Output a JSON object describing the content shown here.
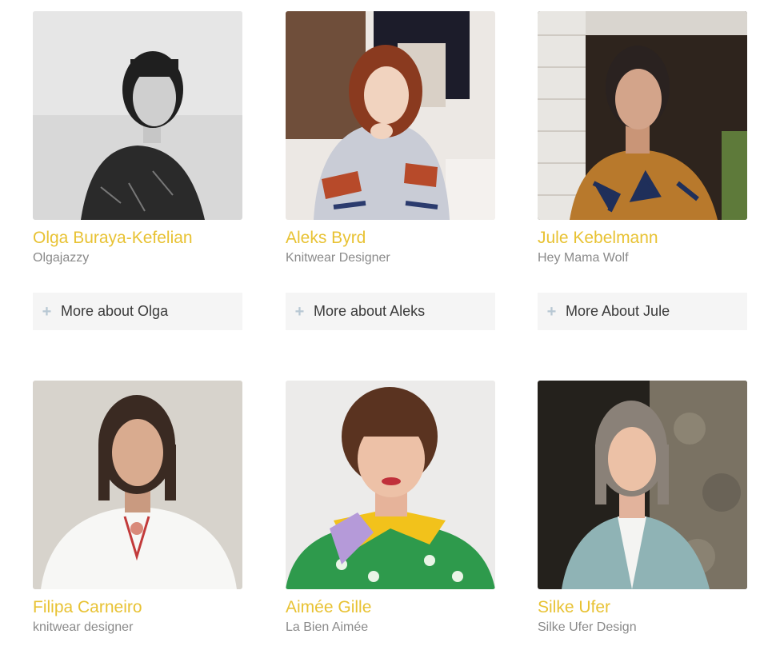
{
  "designers": [
    {
      "name": "Olga Buraya-Kefelian",
      "subtitle": "Olgajazzy",
      "more_label": "More about Olga",
      "photo_alt": "Portrait of Olga Buraya-Kefelian"
    },
    {
      "name": "Aleks Byrd",
      "subtitle": "Knitwear Designer",
      "more_label": "More about Aleks",
      "photo_alt": "Portrait of Aleks Byrd"
    },
    {
      "name": "Jule Kebelmann",
      "subtitle": "Hey Mama Wolf",
      "more_label": "More About Jule",
      "photo_alt": "Portrait of Jule Kebelmann"
    },
    {
      "name": "Filipa Carneiro",
      "subtitle": "knitwear designer",
      "photo_alt": "Portrait of Filipa Carneiro"
    },
    {
      "name": "Aimée Gille",
      "subtitle": "La Bien Aimée",
      "photo_alt": "Portrait of Aimée Gille"
    },
    {
      "name": "Silke Ufer",
      "subtitle": "Silke Ufer Design",
      "photo_alt": "Portrait of Silke Ufer"
    }
  ],
  "icons": {
    "more": "plus-icon"
  },
  "colors": {
    "name": "#e8c233",
    "subtitle": "#8a8a8a",
    "button_bg": "#f5f5f5",
    "plus": "#b7c7d3"
  }
}
